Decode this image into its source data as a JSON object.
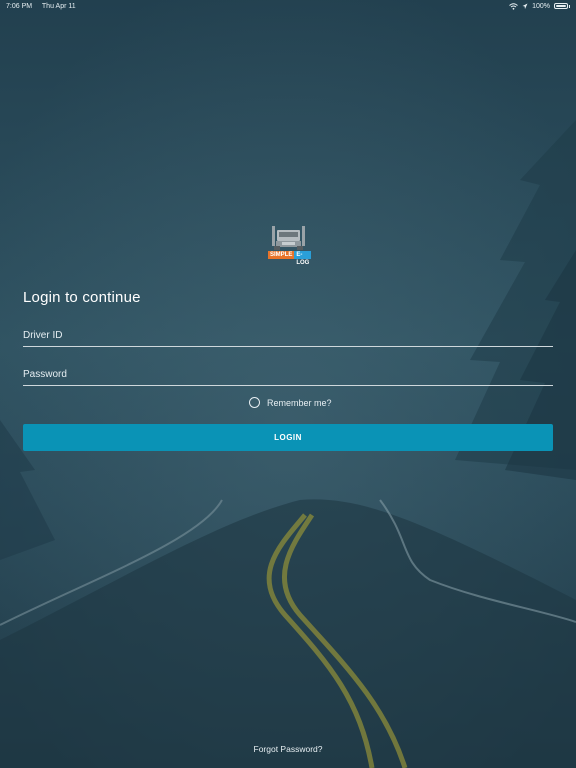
{
  "status_bar": {
    "time": "7:06 PM",
    "date": "Thu Apr 11",
    "battery": "100%"
  },
  "logo": {
    "word1": "SIMPLE",
    "word2": "E-LOG",
    "colors": {
      "orange": "#e8742a",
      "blue": "#2a9fd8"
    }
  },
  "login": {
    "heading": "Login to continue",
    "driver_id_placeholder": "Driver ID",
    "driver_id_value": "",
    "password_placeholder": "Password",
    "password_value": "",
    "remember_label": "Remember me?",
    "remember_checked": false,
    "button_label": "LOGIN",
    "forgot_label": "Forgot Password?"
  },
  "colors": {
    "accent": "#0a93b6",
    "background": "#24414f"
  },
  "icons": [
    "wifi-icon",
    "location-icon",
    "battery-icon",
    "truck-icon"
  ]
}
